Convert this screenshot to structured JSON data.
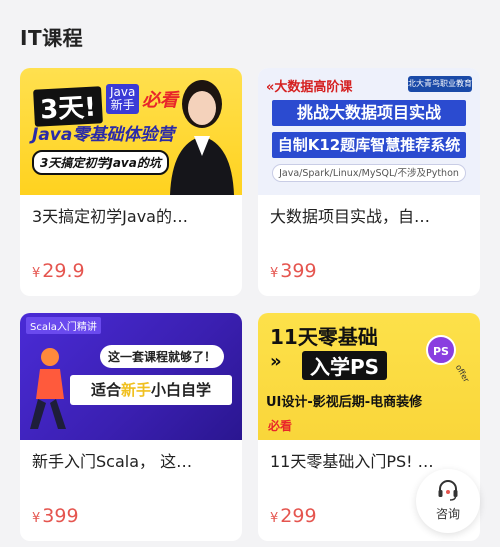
{
  "section": {
    "title": "IT课程"
  },
  "courses": [
    {
      "title": "3天搞定初学Java的…",
      "price": "29.9",
      "currency": "¥",
      "thumb": {
        "big": "3天!",
        "tag": "Java\n新手",
        "must": "必看",
        "line2": "Java零基础体验营",
        "line3": "3天搞定初学Java的坑"
      }
    },
    {
      "title": "大数据项目实战，自…",
      "price": "399",
      "currency": "¥",
      "thumb": {
        "hdr": "«大数据高阶课",
        "logo": "北大青鸟职业教育",
        "bar1": "挑战大数据项目实战",
        "bar2": "自制K12题库智慧推荐系统",
        "sub": "Java/Spark/Linux/MySQL/不涉及Python"
      }
    },
    {
      "title": "新手入门Scala， 这…",
      "price": "399",
      "currency": "¥",
      "thumb": {
        "lbl": "Scala入门精讲",
        "bubble": "这一套课程就够了！",
        "banner_a": "适合",
        "banner_b": "新手",
        "banner_c": "小白自学"
      }
    },
    {
      "title": "11天零基础入门PS! …",
      "price": "299",
      "currency": "¥",
      "thumb": {
        "head": "11天零基础",
        "arrow": "»",
        "ps": "入学PS",
        "badge": "PS",
        "offer": "offer",
        "sub": "UI设计-影视后期-电商装修",
        "must": "必看"
      }
    }
  ],
  "consult": {
    "label": "咨询",
    "icon": "headset-icon"
  },
  "colors": {
    "price": "#e5554f",
    "background": "#f3f3f5",
    "card": "#ffffff"
  }
}
